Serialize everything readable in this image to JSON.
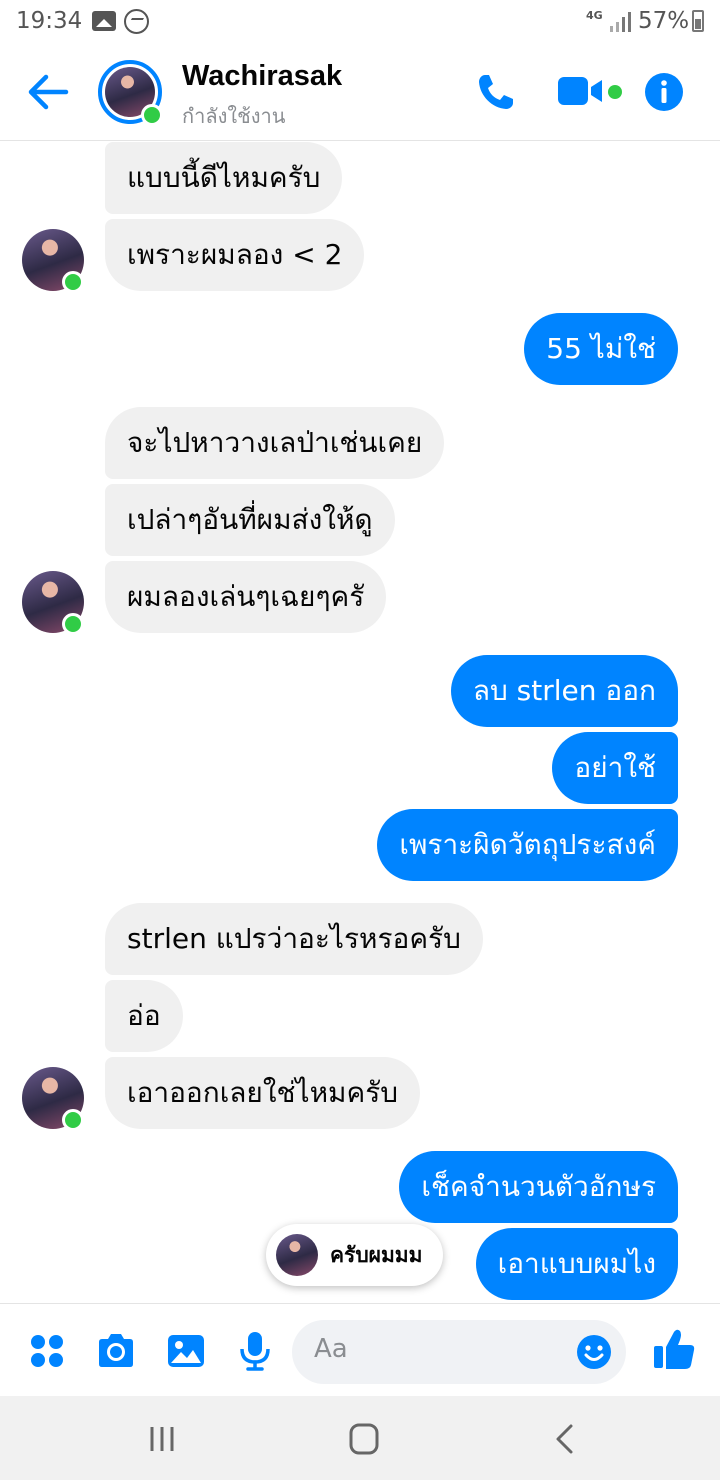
{
  "status_bar": {
    "time": "19:34",
    "network": "4G",
    "battery": "57%"
  },
  "header": {
    "name": "Wachirasak",
    "status": "กำลังใช้งาน"
  },
  "messages": [
    {
      "from": "them",
      "text": "แบบนี้ดีไหมครับ"
    },
    {
      "from": "them",
      "text": "เพราะผมลอง < 2"
    },
    {
      "from": "me",
      "text": "55 ไม่ใช่"
    },
    {
      "from": "them",
      "text": "จะไปหาวางเลป่าเช่นเคย"
    },
    {
      "from": "them",
      "text": "เปล่าๆอันที่ผมส่งให้ดู"
    },
    {
      "from": "them",
      "text": "ผมลองเล่นๆเฉยๆครั"
    },
    {
      "from": "me",
      "text": "ลบ strlen ออก"
    },
    {
      "from": "me",
      "text": "อย่าใช้"
    },
    {
      "from": "me",
      "text": "เพราะผิดวัตถุประสงค์"
    },
    {
      "from": "them",
      "text": "strlen แปรว่าอะไรหรอครับ"
    },
    {
      "from": "them",
      "text": "อ่อ"
    },
    {
      "from": "them",
      "text": "เอาออกเลยใช่ไหมครับ"
    },
    {
      "from": "me",
      "text": "เช็คจำนวนตัวอักษร"
    },
    {
      "from": "me",
      "text": "เอาแบบผมไง"
    }
  ],
  "typing_preview": {
    "text": "ครับผมมม"
  },
  "composer": {
    "placeholder": "Aa"
  },
  "colors": {
    "accent": "#0084ff",
    "online": "#31cc46",
    "incoming_bubble": "#f0f0f0"
  },
  "icons": [
    "back-arrow-icon",
    "phone-icon",
    "video-icon",
    "info-icon",
    "apps-icon",
    "camera-icon",
    "gallery-icon",
    "microphone-icon",
    "emoji-icon",
    "like-icon",
    "recents-icon",
    "home-icon",
    "nav-back-icon"
  ]
}
